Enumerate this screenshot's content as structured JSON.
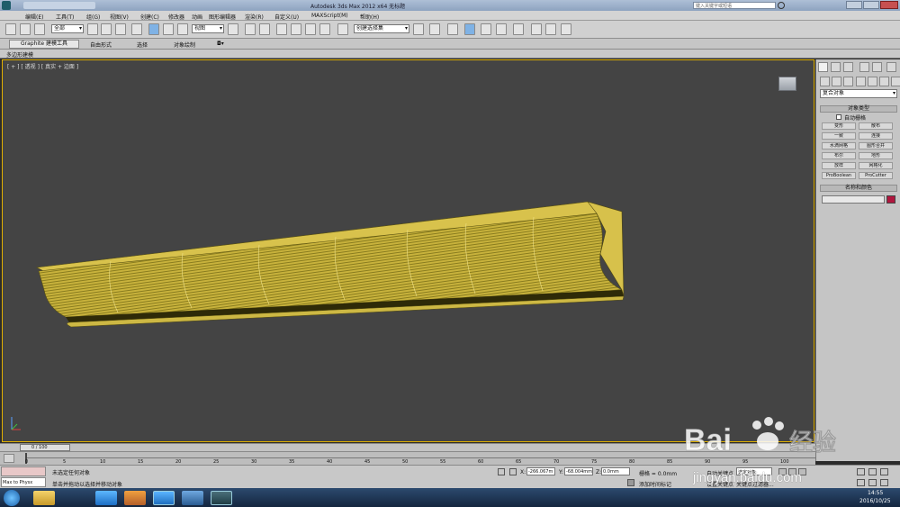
{
  "titlebar": {
    "title": "Autodesk 3ds Max  2012 x64     无标题",
    "search_placeholder": "键入关键字或短语"
  },
  "menubar": {
    "items": [
      "编辑(E)",
      "工具(T)",
      "组(G)",
      "视图(V)",
      "创建(C)",
      "修改器",
      "动画",
      "图形编辑器",
      "渲染(R)",
      "自定义(U)",
      "MAXScript(M)",
      "帮助(H)"
    ]
  },
  "toolbar": {
    "selection_filter": "全部",
    "reference_coord": "视图",
    "named_selection": "创建选择集"
  },
  "ribbon": {
    "tabs": [
      "Graphite 建模工具",
      "自由形式",
      "选择",
      "对象绘制"
    ],
    "sub_label": "多边形建模"
  },
  "viewport": {
    "label": "[ + ] [ 透视 ] [ 真实 + 边面 ]",
    "object_color": "#d6c04a",
    "wire_color": "#4a4300",
    "background": "#444444"
  },
  "command_panel": {
    "category_dropdown": "复合对象",
    "rollout_object_type": "对象类型",
    "autogrid_label": "自动栅格",
    "buttons": [
      "变形",
      "散布",
      "一致",
      "连接",
      "水滴网格",
      "图形合并",
      "布尔",
      "地形",
      "放样",
      "网格化",
      "ProBoolean",
      "ProCutter"
    ],
    "rollout_name_color": "名称和颜色",
    "name_swatch_color": "#b0163e"
  },
  "timeline": {
    "frame_readout": "0 / 100",
    "ticks": [
      "0",
      "5",
      "10",
      "15",
      "20",
      "25",
      "30",
      "35",
      "40",
      "45",
      "50",
      "55",
      "60",
      "65",
      "70",
      "75",
      "80",
      "85",
      "90",
      "95",
      "100"
    ]
  },
  "status": {
    "max_for_physx": "Max to Physx",
    "line1": "未选定任何对象",
    "line2": "单击并拖动以选择并移动对象",
    "x_label": "X:",
    "x_value": "-266.067m",
    "y_label": "Y:",
    "y_value": "-68.004mm",
    "z_label": "Z:",
    "z_value": "0.0mm",
    "grid": "栅格 = 0.0mm",
    "add_time_tag": "添加时间标记",
    "auto_key": "自动关键点",
    "key_mode": "选定对象",
    "set_key": "设置关键点",
    "key_filters": "关键点过滤器..."
  },
  "taskbar": {
    "time": "14:55",
    "date": "2016/10/25"
  },
  "watermark": {
    "logo": "Bai du 经验",
    "url": "jingyan.baidu.com"
  }
}
